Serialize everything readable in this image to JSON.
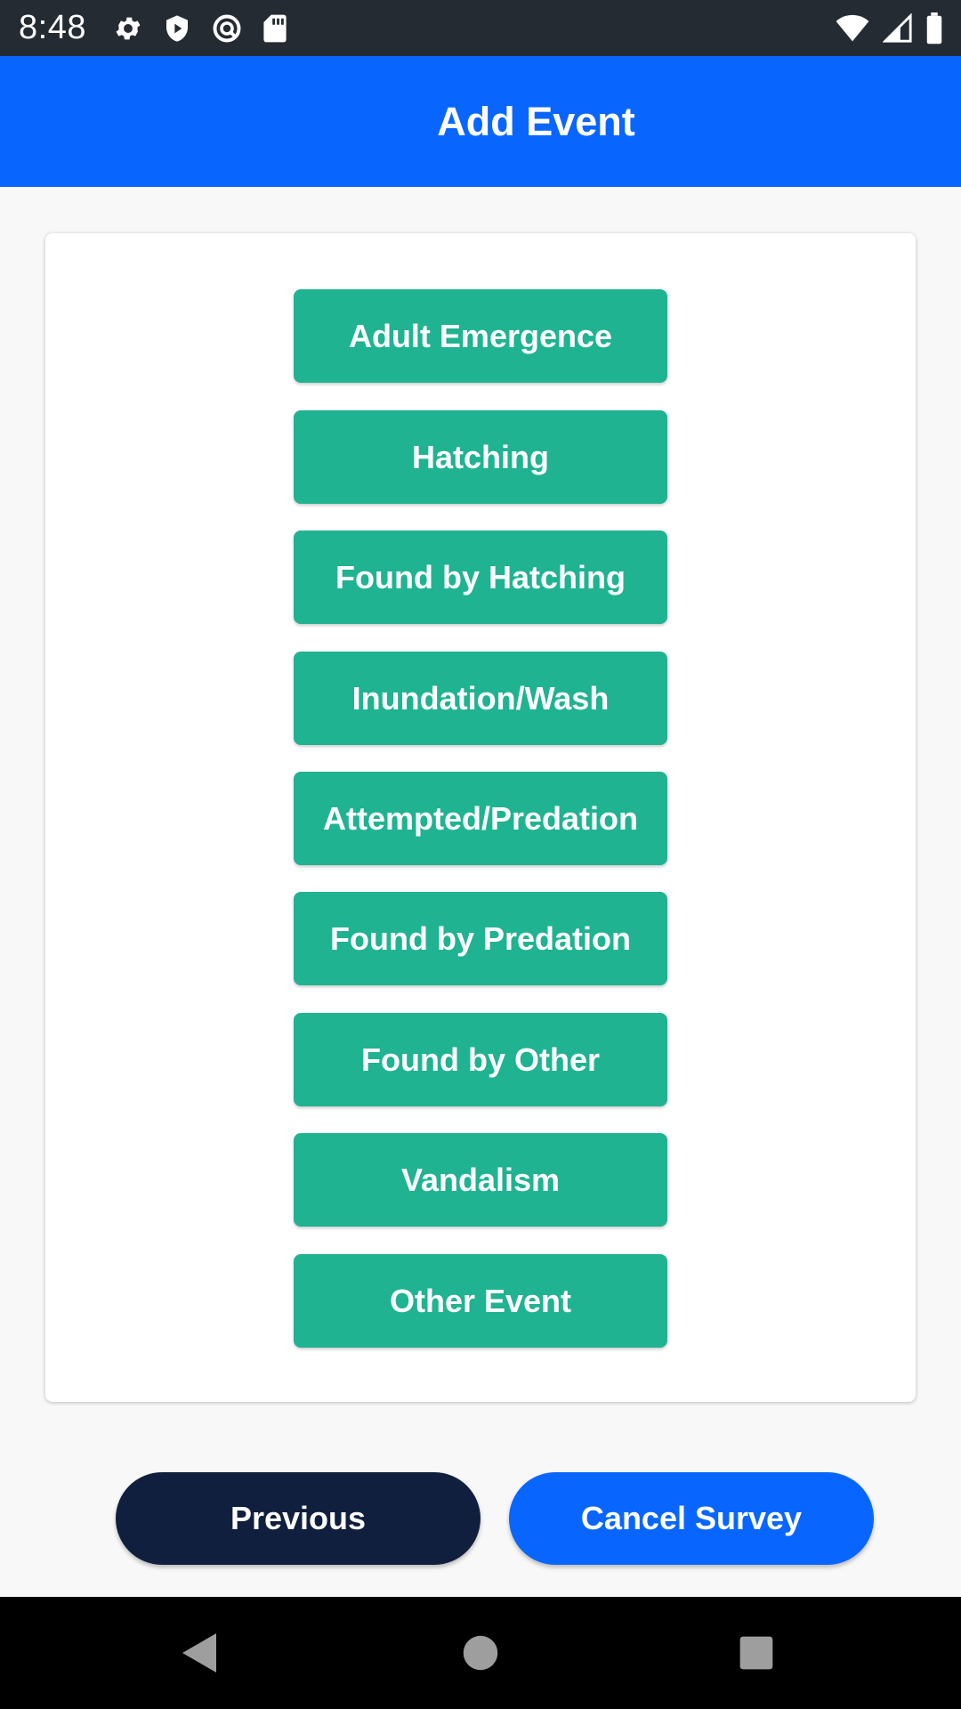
{
  "status_bar": {
    "time": "8:48",
    "left_icons": [
      "settings-icon",
      "shield-icon",
      "sync-icon",
      "sd-card-icon"
    ],
    "right_icons": [
      "wifi-icon",
      "signal-icon",
      "battery-icon"
    ]
  },
  "app_bar": {
    "title": "Add Event"
  },
  "events": [
    {
      "label": "Adult Emergence"
    },
    {
      "label": "Hatching"
    },
    {
      "label": "Found by Hatching"
    },
    {
      "label": "Inundation/Wash"
    },
    {
      "label": "Attempted/Predation"
    },
    {
      "label": "Found by Predation"
    },
    {
      "label": "Found by Other"
    },
    {
      "label": "Vandalism"
    },
    {
      "label": "Other Event"
    }
  ],
  "footer": {
    "previous_label": "Previous",
    "cancel_label": "Cancel Survey"
  },
  "nav_bar": {
    "icons": [
      "back-icon",
      "home-icon",
      "recents-icon"
    ]
  },
  "colors": {
    "primary": "#0866ff",
    "event_button": "#1fb391",
    "previous_button": "#101f3d",
    "status_bar": "#252b33"
  }
}
